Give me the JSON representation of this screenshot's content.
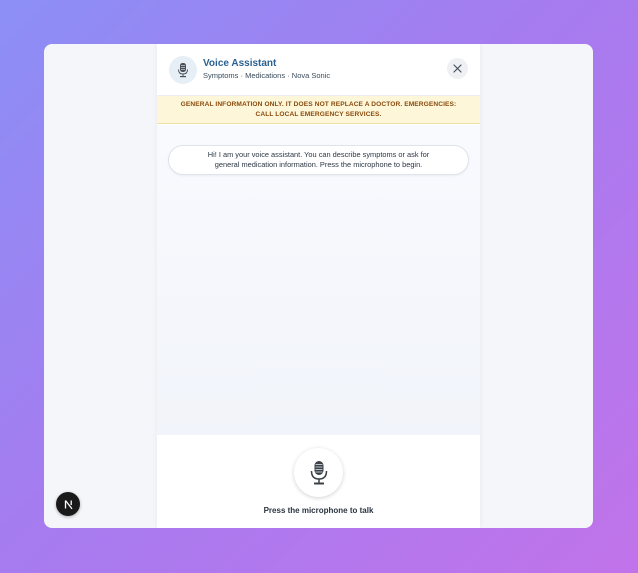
{
  "header": {
    "title": "Voice Assistant",
    "subtitle": "Symptoms · Medications · Nova Sonic",
    "icon": "microphone-icon",
    "close_icon": "close-icon"
  },
  "banner": {
    "text": "GENERAL INFORMATION ONLY. IT DOES NOT REPLACE A DOCTOR. EMERGENCIES: CALL LOCAL EMERGENCY SERVICES."
  },
  "chat": {
    "messages": [
      {
        "role": "assistant",
        "text": "Hi! I am your voice assistant. You can describe symptoms or ask for general medication information. Press the microphone to begin."
      }
    ]
  },
  "footer": {
    "mic_icon": "microphone-icon",
    "label": "Press the microphone to talk"
  },
  "badge": {
    "letter": "N"
  },
  "colors": {
    "accent": "#2a6190",
    "banner_bg": "#fdf6d9",
    "banner_text": "#8a4b0c"
  }
}
